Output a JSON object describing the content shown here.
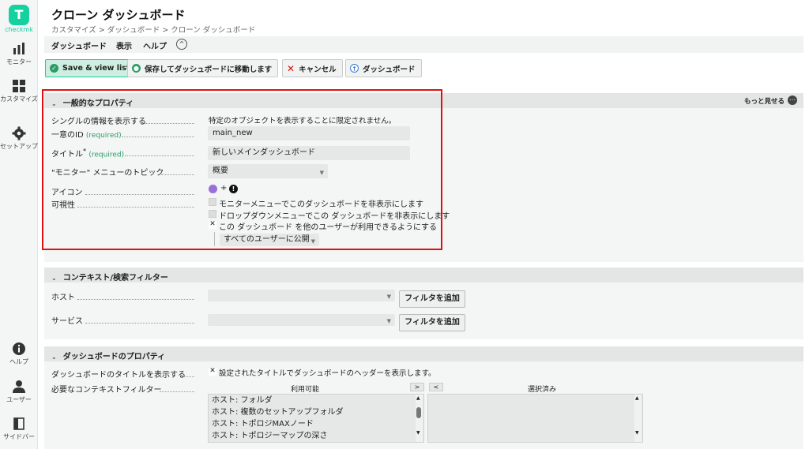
{
  "sidebar": {
    "logo_letter": "T",
    "logo_text": "checkmk",
    "items": [
      {
        "label": "モニター",
        "icon": "bar-chart-icon"
      },
      {
        "label": "カスタマイズ",
        "icon": "grid-icon"
      },
      {
        "label": "セットアップ",
        "icon": "gear-icon"
      },
      {
        "label": "ヘルプ",
        "icon": "info-icon"
      },
      {
        "label": "ユーザー",
        "icon": "user-icon"
      },
      {
        "label": "サイドバー",
        "icon": "sidebar-icon"
      }
    ]
  },
  "header": {
    "title": "クローン ダッシュボード",
    "breadcrumb": "カスタマイズ > ダッシュボード > クローン ダッシュボード"
  },
  "menubar": {
    "items": [
      "ダッシュボード",
      "表示",
      "ヘルプ"
    ],
    "toggle": "^"
  },
  "toolbar": {
    "save_view_list": "Save & view list",
    "save_go_dashboard": "保存してダッシュボードに移動します",
    "cancel": "キャンセル",
    "dashboard": "ダッシュボード"
  },
  "general": {
    "title": "一般的なプロパティ",
    "show_more": "もっと見せる",
    "single_info_label": "シングルの情報を表示する",
    "single_info_value": "特定のオブジェクトを表示することに限定されません。",
    "unique_id_label": "一意のID",
    "required": "(required)",
    "unique_id_value": "main_new",
    "title_label": "タイトル",
    "title_star": "*",
    "title_value": "新しいメインダッシュボード",
    "topic_label": "\"モニター\" メニューのトピック",
    "topic_value": "概要",
    "icon_label": "アイコン",
    "icon_plus": "+",
    "visibility_label": "可視性",
    "hide_monitor_menu": "モニターメニューでこのダッシュボードを非表示にします",
    "hide_dropdown": "ドロップダウンメニューでこの ダッシュボードを非表示にします",
    "share_users": "この ダッシュボード を他のユーザーが利用できるようにする",
    "public_to_all": "すべてのユーザーに公開"
  },
  "context": {
    "title": "コンテキスト/検索フィルター",
    "host_label": "ホスト",
    "service_label": "サービス",
    "add_filter": "フィルタを追加"
  },
  "dash_props": {
    "title": "ダッシュボードのプロパティ",
    "show_title_label": "ダッシュボードのタイトルを表示する",
    "show_title_value": "設定されたタイトルでダッシュボードのヘッダーを表示します。",
    "required_filters_label": "必要なコンテキストフィルター",
    "available": "利用可能",
    "selected": "選択済み",
    "move_right": ">",
    "move_left": "<",
    "available_items": [
      "ホスト: フォルダ",
      "ホスト: 複数のセットアップフォルダ",
      "ホスト: トポロジMAXノード",
      "ホスト: トポロジーマップの深さ"
    ]
  },
  "colors": {
    "accent": "#15d1a0",
    "highlight": "#e01010",
    "required": "#2a9c66"
  }
}
